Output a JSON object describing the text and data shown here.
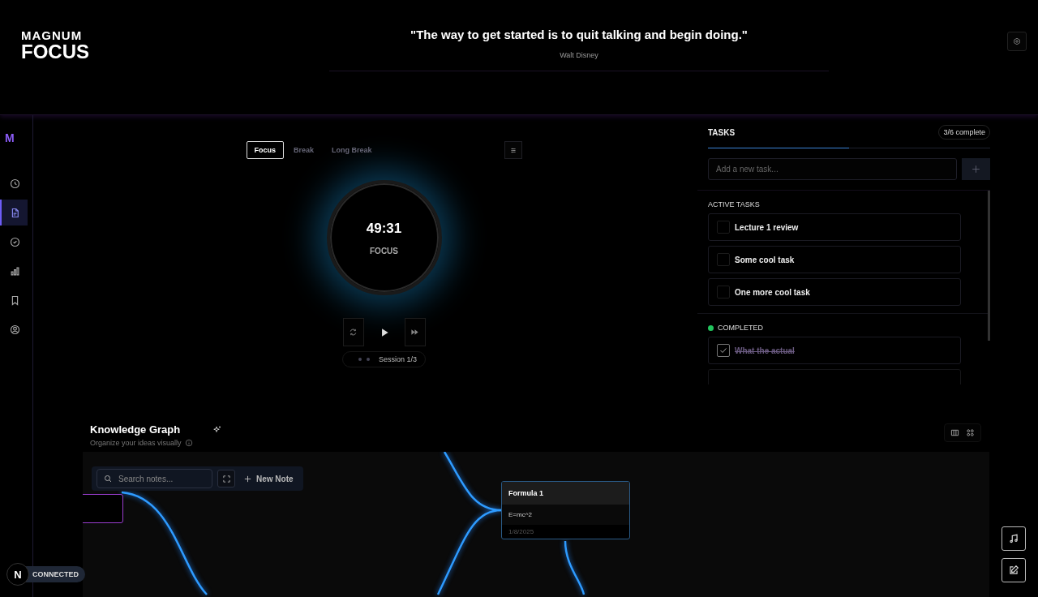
{
  "header": {
    "logo_top": "MAGNUM",
    "logo_bottom": "FOCUS",
    "quote": "\"The way to get started is to quit talking and begin doing.\"",
    "author": "Walt Disney"
  },
  "sidebar": {
    "logo": "M",
    "items": [
      {
        "kind": "clock",
        "selected": false
      },
      {
        "kind": "note",
        "selected": true
      },
      {
        "kind": "check",
        "selected": false
      },
      {
        "kind": "chart",
        "selected": false
      },
      {
        "kind": "bookmark",
        "selected": false
      },
      {
        "kind": "user",
        "selected": false
      }
    ]
  },
  "timer": {
    "modes": [
      {
        "label": "Focus",
        "selected": true
      },
      {
        "label": "Break",
        "selected": false
      },
      {
        "label": "Long Break",
        "selected": false
      }
    ],
    "time": "49:31",
    "phase": "FOCUS",
    "session": "Session 1/3"
  },
  "tasks": {
    "title": "TASKS",
    "count": "3/6 complete",
    "progress": {
      "level": 0.5
    },
    "input": {
      "placeholder": "Add a new task..."
    },
    "active_heading": "ACTIVE TASKS",
    "active": [
      {
        "label": "Lecture 1 review",
        "checked": false
      },
      {
        "label": "Some cool task",
        "checked": false
      },
      {
        "label": "One more cool task",
        "checked": false
      }
    ],
    "completed_heading": "COMPLETED",
    "completed": [
      {
        "label": "What the actual",
        "checked": true
      }
    ]
  },
  "graph": {
    "title": "Knowledge Graph",
    "subtitle": "Organize your ideas visually",
    "search": {
      "placeholder": "Search notes..."
    },
    "new_note": "New Note",
    "nodes": [
      {
        "title": "Formula 1",
        "body": "E=mc^2",
        "date": "1/8/2025"
      }
    ]
  },
  "status": {
    "badge": "N",
    "label": "CONNECTED"
  }
}
